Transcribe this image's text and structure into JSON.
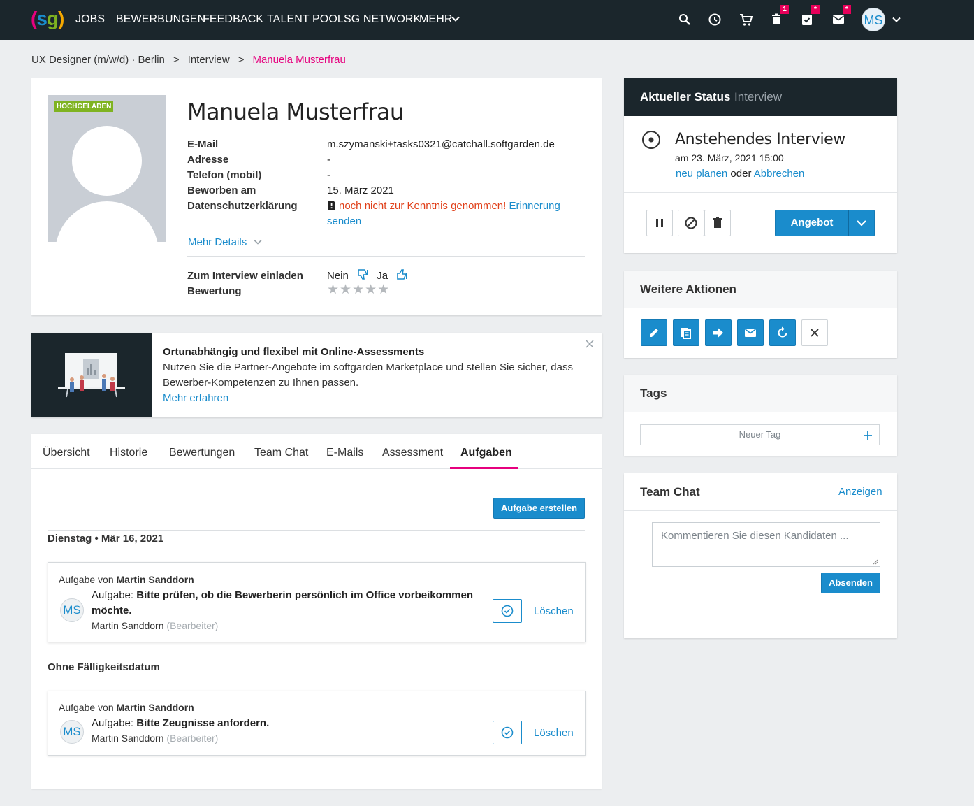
{
  "nav": {
    "logo": "(sg)",
    "items": [
      "JOBS",
      "BEWERBUNGEN",
      "FEEDBACK",
      "TALENT POOL",
      "SG NETWORK",
      "MEHR"
    ],
    "badges": {
      "trash": "1",
      "tasks": "*",
      "mail": "*"
    },
    "avatar": "MS",
    "colors": {
      "bg": "#1b262c",
      "badge": "#e8005a"
    }
  },
  "breadcrumb": {
    "job": "UX Designer (m/w/d) · Berlin",
    "sep1": ">",
    "stage": "Interview",
    "sep2": ">",
    "current": "Manuela Musterfrau"
  },
  "profile": {
    "photo_badge": "HOCHGELADEN",
    "name": "Manuela Musterfrau",
    "fields": [
      {
        "label": "E-Mail",
        "value": "m.szymanski+tasks0321@catchall.softgarden.de"
      },
      {
        "label": "Adresse",
        "value": "-"
      },
      {
        "label": "Telefon (mobil)",
        "value": "-"
      },
      {
        "label": "Beworben am",
        "value": "15. März 2021"
      },
      {
        "label": "Datenschutzerklärung",
        "value": "noch nicht zur Kenntnis genommen!",
        "link1": "Erinnerung",
        "link2": "senden"
      }
    ],
    "more_details": "Mehr Details",
    "invite_label": "Zum Interview einladen",
    "invite_no": "Nein",
    "invite_yes": "Ja",
    "rating_label": "Bewertung",
    "rating": 0,
    "rating_max": 5
  },
  "promo": {
    "title": "Ortunabhängig und flexibel mit Online-Assessments",
    "text1": "Nutzen Sie die Partner-Angebote im softgarden Marketplace und stellen Sie sicher, dass",
    "text2": "Bewerber-Kompetenzen zu Ihnen passen.",
    "link": "Mehr erfahren"
  },
  "tabs": {
    "items": [
      "Übersicht",
      "Historie",
      "Bewertungen",
      "Team Chat",
      "E-Mails",
      "Assessment",
      "Aufgaben"
    ],
    "active": "Aufgaben"
  },
  "tasks": {
    "create_button": "Aufgabe erstellen",
    "group1_date": "Dienstag • Mär 16, 2021",
    "group2_date": "Ohne Fälligkeitsdatum",
    "items": [
      {
        "from_prefix": "Aufgabe von",
        "from_name": "Martin Sanddorn",
        "avatar": "MS",
        "task_prefix": "Aufgabe:",
        "task_line1": "Bitte prüfen, ob die Bewerberin persönlich im Office vorbeikommen",
        "task_line2": "möchte.",
        "assignee": "Martin Sanddorn",
        "assignee_role": "(Bearbeiter)",
        "delete": "Löschen"
      },
      {
        "from_prefix": "Aufgabe von",
        "from_name": "Martin Sanddorn",
        "avatar": "MS",
        "task_prefix": "Aufgabe:",
        "task_line1": "Bitte Zeugnisse anfordern.",
        "assignee": "Martin Sanddorn",
        "assignee_role": "(Bearbeiter)",
        "delete": "Löschen"
      }
    ]
  },
  "status": {
    "title": "Aktueller Status",
    "stage": "Interview",
    "event_title": "Anstehendes Interview",
    "event_date": "am 23. März, 2021 15:00",
    "reschedule": "neu planen",
    "or": "oder",
    "cancel": "Abbrechen",
    "offer_button": "Angebot"
  },
  "actions": {
    "title": "Weitere Aktionen"
  },
  "tags": {
    "title": "Tags",
    "placeholder": "Neuer Tag"
  },
  "chat": {
    "title": "Team Chat",
    "show": "Anzeigen",
    "placeholder": "Kommentieren Sie diesen Kandidaten ...",
    "send": "Absenden"
  },
  "colors": {
    "accent": "#1a8ccc",
    "pink": "#e6007e",
    "warning": "#e0401a",
    "rating_badge": "#7fb321"
  }
}
